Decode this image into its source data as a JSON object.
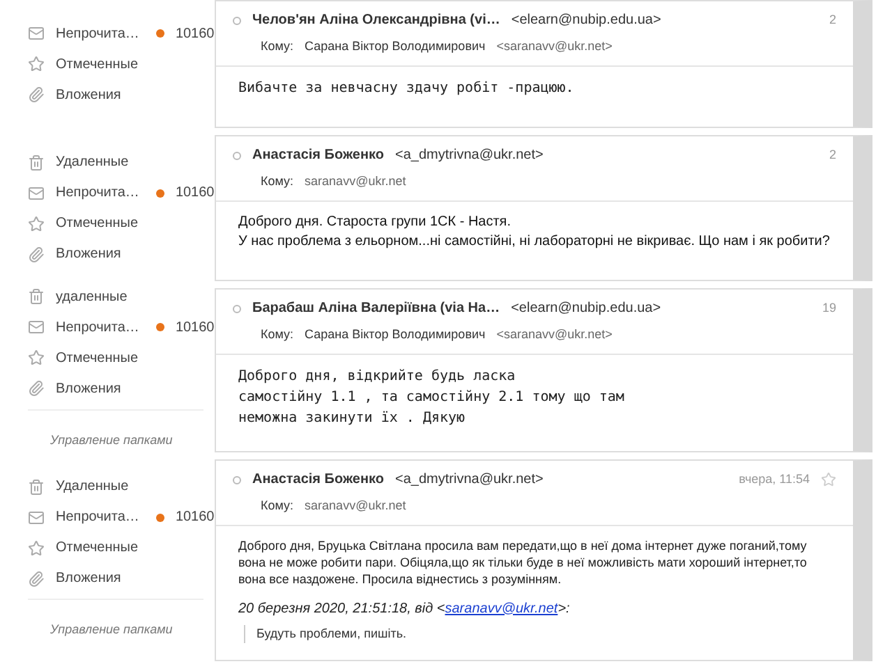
{
  "panels": [
    {
      "sidebar": {
        "items": [
          {
            "kind": "unread",
            "label": "Непрочита…",
            "count": "10160"
          },
          {
            "kind": "starred",
            "label": "Отмеченные"
          },
          {
            "kind": "attachments",
            "label": "Вложения"
          }
        ]
      },
      "message": {
        "sender_name": "Челов'ян Аліна Олександрівна (vi…",
        "sender_email": "<elearn@nubip.edu.ua>",
        "date": "2",
        "to_label": "Кому:",
        "to_name": "Сарана Віктор Володимирович",
        "to_email": "<saranavv@ukr.net>",
        "kind": "mono",
        "body": [
          "Вибачте за невчасну здачу робіт -працюю."
        ]
      }
    },
    {
      "sidebar": {
        "items": [
          {
            "kind": "trash",
            "label": "Удаленные"
          },
          {
            "kind": "unread",
            "label": "Непрочита…",
            "count": "10160"
          },
          {
            "kind": "starred",
            "label": "Отмеченные"
          },
          {
            "kind": "attachments",
            "label": "Вложения"
          }
        ]
      },
      "message": {
        "sender_name": "Анастасія Боженко",
        "sender_email": "<a_dmytrivna@ukr.net>",
        "date": "2",
        "to_label": "Кому:",
        "to_email": "saranavv@ukr.net",
        "kind": "large",
        "body": [
          "Доброго дня. Староста групи 1СК - Настя.",
          "У нас проблема з ельорном...ні самостійні, ні лабораторні не вікриває. Що нам і як робити?"
        ]
      }
    },
    {
      "sidebar": {
        "items": [
          {
            "kind": "trash",
            "label": "удаленные"
          },
          {
            "kind": "unread",
            "label": "Непрочита…",
            "count": "10160"
          },
          {
            "kind": "starred",
            "label": "Отмеченные"
          },
          {
            "kind": "attachments",
            "label": "Вложения"
          }
        ],
        "folders_link": "Управление папками"
      },
      "message": {
        "sender_name": "Барабаш Аліна Валеріївна (via На…",
        "sender_email": "<elearn@nubip.edu.ua>",
        "date": "19",
        "to_label": "Кому:",
        "to_name": "Сарана Віктор Володимирович",
        "to_email": "<saranavv@ukr.net>",
        "kind": "mono",
        "body": [
          "Доброго дня, відкрийте будь ласка",
          "самостійну 1.1 , та самостійну 2.1 тому що там",
          "неможна закинути їх . Дякую"
        ]
      }
    },
    {
      "sidebar": {
        "items": [
          {
            "kind": "trash",
            "label": "Удаленные"
          },
          {
            "kind": "unread",
            "label": "Непрочита…",
            "count": "10160"
          },
          {
            "kind": "starred",
            "label": "Отмеченные"
          },
          {
            "kind": "attachments",
            "label": "Вложения"
          }
        ],
        "folders_link": "Управление папками"
      },
      "message": {
        "sender_name": "Анастасія Боженко",
        "sender_email": "<a_dmytrivna@ukr.net>",
        "date": "вчера, 11:54",
        "starred": false,
        "to_label": "Кому:",
        "to_email": "saranavv@ukr.net",
        "kind": "small",
        "body": [
          "Доброго дня, Бруцька Світлана просила вам передати,що в неї дома інтернет дуже поганий,тому вона не може робити пари. Обіцяла,що як тільки буде в неї можливість мати хороший інтернет,то вона все наздожене. Просила віднестись з розумінням."
        ],
        "quote_header": {
          "before": "20 березня 2020, 21:51:18, від <",
          "link": "saranavv@ukr.net",
          "after": ">:"
        },
        "quote": "Будуть проблеми, пишіть."
      }
    }
  ]
}
